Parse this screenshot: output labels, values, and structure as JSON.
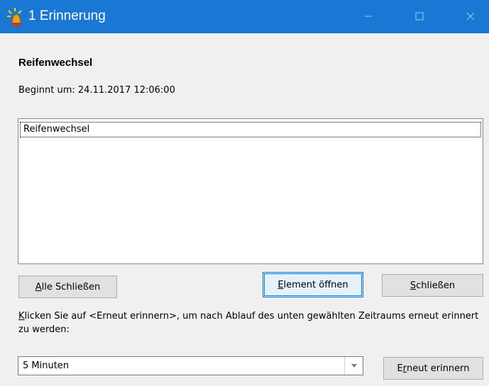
{
  "window": {
    "title": "1 Erinnerung",
    "icon": "reminder-bell-icon"
  },
  "titlebar": {
    "minimize_icon": "minimize-icon",
    "maximize_icon": "maximize-icon",
    "close_icon": "close-icon",
    "accent": "#1978d4"
  },
  "reminder": {
    "subject": "Reifenwechsel",
    "begin_text": "Beginnt um: 24.11.2017 12:06:00"
  },
  "list": {
    "items": [
      {
        "label": "Reifenwechsel",
        "selected": true
      }
    ]
  },
  "buttons": {
    "dismiss_all": {
      "mnemonic": "A",
      "rest": "lle Schließen"
    },
    "open_item": {
      "mnemonic": "E",
      "rest": "lement öffnen"
    },
    "dismiss": {
      "mnemonic": "S",
      "rest": "chließen"
    },
    "snooze": {
      "pre": "E",
      "mnemonic": "r",
      "rest": "neut erinnern"
    }
  },
  "hint": {
    "mnemonic": "K",
    "rest": "licken Sie auf <Erneut erinnern>, um nach Ablauf des unten gewählten Zeitraums erneut erinnert zu werden:"
  },
  "snooze_select": {
    "selected": "5 Minuten",
    "arrow_icon": "chevron-down-icon"
  }
}
